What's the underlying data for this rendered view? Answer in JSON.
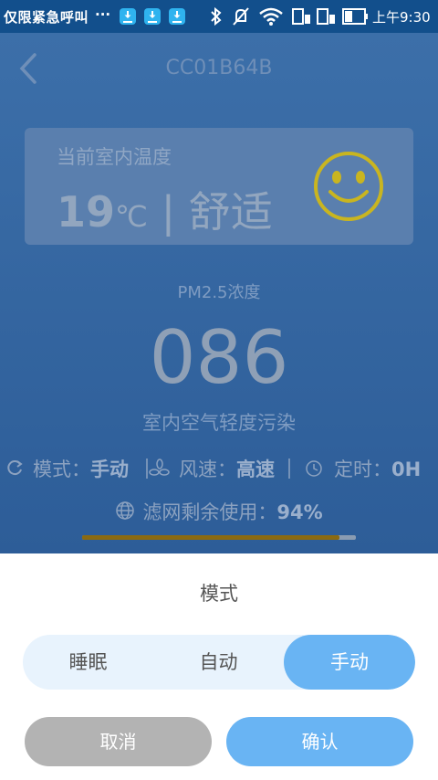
{
  "status_bar": {
    "carrier": "仅限紧急呼叫",
    "overflow": "···",
    "time": "上午9:30"
  },
  "header": {
    "back_icon": "chevron-left-icon",
    "device_name": "CC01B64B"
  },
  "temperature_card": {
    "label": "当前室内温度",
    "value": "19",
    "unit": "℃",
    "separator": "|",
    "comfort": "舒适",
    "face_icon": "smiley-face-icon"
  },
  "pm25": {
    "label": "PM2.5浓度",
    "value": "086",
    "quality": "室内空气轻度污染"
  },
  "info": {
    "mode_label": "模式：",
    "mode_value": "手动",
    "speed_label": "风速：",
    "speed_value": "高速",
    "timer_label": "定时：",
    "timer_value": "0H"
  },
  "filter": {
    "label": "滤网剩余使用：",
    "value": "94%",
    "percent": 94
  },
  "sheet": {
    "title": "模式",
    "options": [
      "睡眠",
      "自动",
      "手动"
    ],
    "selected_index": 2,
    "cancel": "取消",
    "confirm": "确认"
  },
  "colors": {
    "accent": "#69b4f3",
    "status_bar": "#124f8c",
    "smiley": "#c9b520",
    "progress": "#8a6a12"
  }
}
